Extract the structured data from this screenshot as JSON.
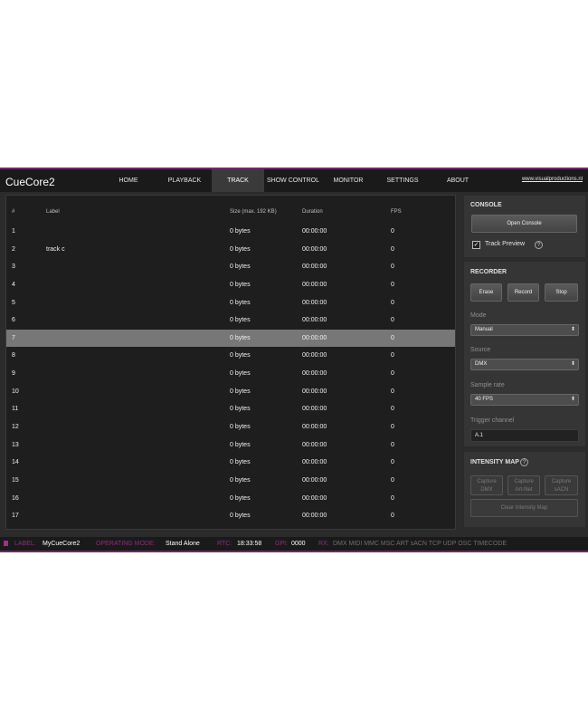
{
  "app": {
    "brand": "CueCore2",
    "site_link": "www.visualproductions.nl"
  },
  "nav": [
    {
      "label": "HOME",
      "active": false
    },
    {
      "label": "PLAYBACK",
      "active": false
    },
    {
      "label": "TRACK",
      "active": true
    },
    {
      "label": "SHOW CONTROL",
      "active": false
    },
    {
      "label": "MONITOR",
      "active": false
    },
    {
      "label": "SETTINGS",
      "active": false
    },
    {
      "label": "ABOUT",
      "active": false
    }
  ],
  "table": {
    "headers": {
      "num": "#",
      "label": "Label",
      "size": "Size (max. 192 KB)",
      "duration": "Duration",
      "fps": "FPS"
    },
    "selected_row": 7,
    "rows": [
      {
        "num": "1",
        "label": "",
        "size": "0 bytes",
        "duration": "00:00:00",
        "fps": "0"
      },
      {
        "num": "2",
        "label": "track c",
        "size": "0 bytes",
        "duration": "00:00:00",
        "fps": "0"
      },
      {
        "num": "3",
        "label": "",
        "size": "0 bytes",
        "duration": "00:00:00",
        "fps": "0"
      },
      {
        "num": "4",
        "label": "",
        "size": "0 bytes",
        "duration": "00:00:00",
        "fps": "0"
      },
      {
        "num": "5",
        "label": "",
        "size": "0 bytes",
        "duration": "00:00:00",
        "fps": "0"
      },
      {
        "num": "6",
        "label": "",
        "size": "0 bytes",
        "duration": "00:00:00",
        "fps": "0"
      },
      {
        "num": "7",
        "label": "",
        "size": "0 bytes",
        "duration": "00:00:00",
        "fps": "0"
      },
      {
        "num": "8",
        "label": "",
        "size": "0 bytes",
        "duration": "00:00:00",
        "fps": "0"
      },
      {
        "num": "9",
        "label": "",
        "size": "0 bytes",
        "duration": "00:00:00",
        "fps": "0"
      },
      {
        "num": "10",
        "label": "",
        "size": "0 bytes",
        "duration": "00:00:00",
        "fps": "0"
      },
      {
        "num": "11",
        "label": "",
        "size": "0 bytes",
        "duration": "00:00:00",
        "fps": "0"
      },
      {
        "num": "12",
        "label": "",
        "size": "0 bytes",
        "duration": "00:00:00",
        "fps": "0"
      },
      {
        "num": "13",
        "label": "",
        "size": "0 bytes",
        "duration": "00:00:00",
        "fps": "0"
      },
      {
        "num": "14",
        "label": "",
        "size": "0 bytes",
        "duration": "00:00:00",
        "fps": "0"
      },
      {
        "num": "15",
        "label": "",
        "size": "0 bytes",
        "duration": "00:00:00",
        "fps": "0"
      },
      {
        "num": "16",
        "label": "",
        "size": "0 bytes",
        "duration": "00:00:00",
        "fps": "0"
      },
      {
        "num": "17",
        "label": "",
        "size": "0 bytes",
        "duration": "00:00:00",
        "fps": "0"
      }
    ]
  },
  "console": {
    "title": "CONSOLE",
    "open_button": "Open Console",
    "track_preview_label": "Track Preview",
    "track_preview_checked": true,
    "help_symbol": "?"
  },
  "recorder": {
    "title": "RECORDER",
    "erase": "Erase",
    "record": "Record",
    "stop": "Stop",
    "mode_label": "Mode",
    "mode_value": "Manual",
    "source_label": "Source",
    "source_value": "DMX",
    "sample_rate_label": "Sample rate",
    "sample_rate_value": "40 FPS",
    "trigger_label": "Trigger channel",
    "trigger_value": "A.1",
    "dropdown_arrow": "⬍"
  },
  "intensity_map": {
    "title": "INTENSITY MAP",
    "help_symbol": "?",
    "capture_dmx": [
      "Capture",
      "DMX"
    ],
    "capture_artnet": [
      "Capture",
      "Art-Net"
    ],
    "capture_sacn": [
      "Capture",
      "sACN"
    ],
    "clear": "Clear Intensity Map"
  },
  "status": {
    "label_key": "LABEL:",
    "label_value": "MyCueCore2",
    "mode_key": "OPERATING MODE:",
    "mode_value": "Stand Alone",
    "rtc_key": "RTC:",
    "rtc_value": "18:33:58",
    "gpi_key": "GPI:",
    "gpi_value": "0000",
    "rx_key": "RX:",
    "rx_protocols": "DMX MIDI MMC MSC ART sACN TCP UDP OSC TIMECODE"
  },
  "colors": {
    "accent": "#8b2d80",
    "panel": "#353535",
    "table_bg": "#1e1e1e",
    "selected_row": "#777777"
  }
}
